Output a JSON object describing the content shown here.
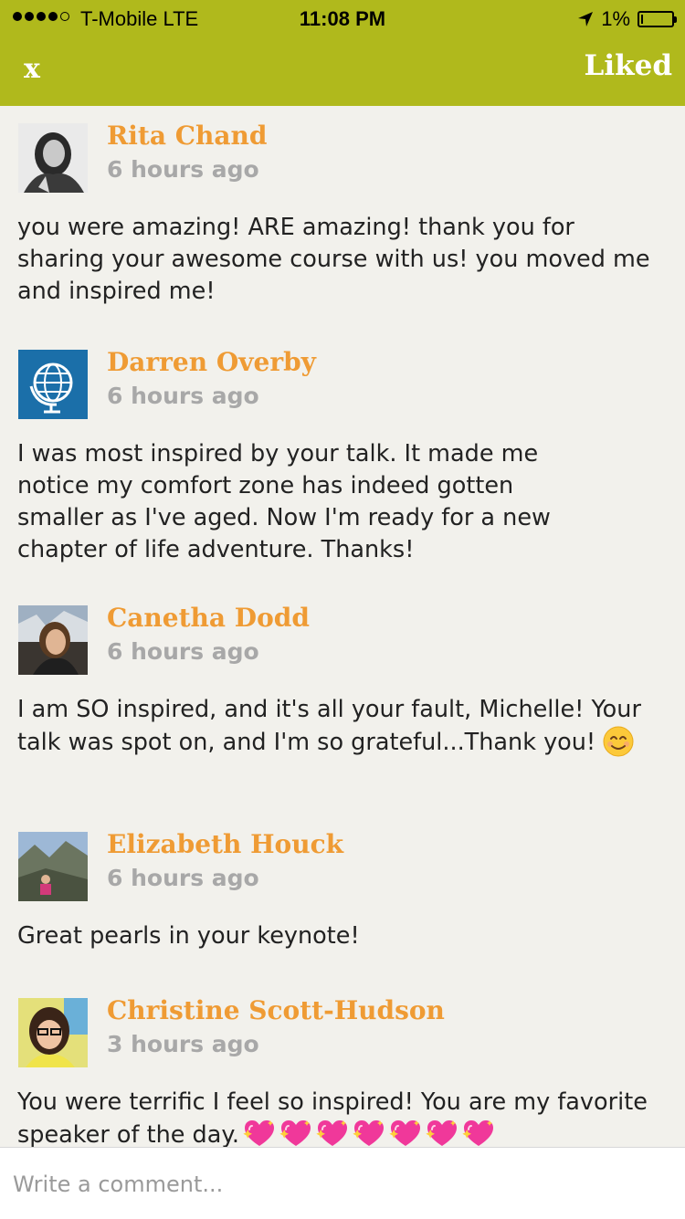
{
  "status_bar": {
    "carrier": "T-Mobile  LTE",
    "time": "11:08 PM",
    "battery": "1%"
  },
  "nav": {
    "close_label": "x",
    "liked_label": "Liked"
  },
  "comments": [
    {
      "name": "Rita Chand",
      "time": "6 hours ago",
      "text": "you were amazing! ARE amazing! thank you for sharing your awesome course with us! you moved me and inspired me!"
    },
    {
      "name": "Darren Overby",
      "time": "6 hours ago",
      "text": "I was most inspired by your talk.  It made me notice my comfort zone has indeed gotten smaller as I've aged.   Now I'm ready for a new chapter of life adventure.  Thanks!"
    },
    {
      "name": "Canetha Dodd",
      "time": "6 hours ago",
      "text": "I am SO inspired, and it's all your fault, Michelle! Your talk was spot on, and I'm so grateful...Thank you!"
    },
    {
      "name": "Elizabeth Houck",
      "time": "6 hours ago",
      "text": "Great pearls in your keynote!"
    },
    {
      "name": "Christine Scott-Hudson",
      "time": "3 hours ago",
      "text": "You were terrific I feel so inspired! You are my favorite speaker of the day."
    }
  ],
  "composer": {
    "placeholder": "Write a comment..."
  },
  "colors": {
    "header": "#b0b91c",
    "name": "#ef9b34",
    "background": "#f2f1ec"
  }
}
